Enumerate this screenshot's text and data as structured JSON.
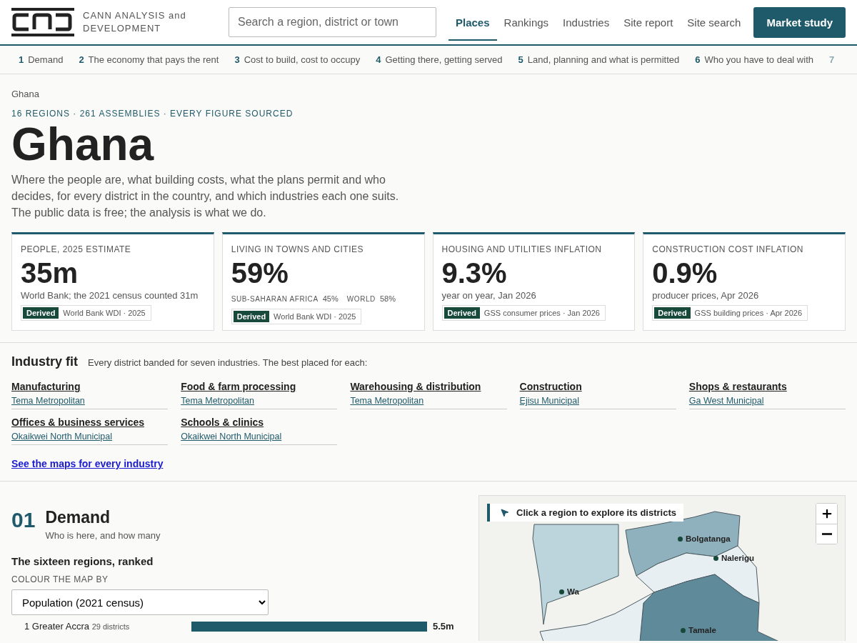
{
  "header": {
    "brand": "CANN ANALYSIS and DEVELOPMENT",
    "search": {
      "placeholder": "Search a region, district or town"
    },
    "nav": [
      {
        "label": "Places",
        "selected": true
      },
      {
        "label": "Rankings",
        "selected": false
      },
      {
        "label": "Industries",
        "selected": false
      },
      {
        "label": "Site report",
        "selected": false
      },
      {
        "label": "Site search",
        "selected": false
      }
    ],
    "cta": "Market study"
  },
  "chapters": [
    {
      "number": "1",
      "label": "Demand"
    },
    {
      "number": "2",
      "label": "The economy that pays the rent"
    },
    {
      "number": "3",
      "label": "Cost to build, cost to occupy"
    },
    {
      "number": "4",
      "label": "Getting there, getting served"
    },
    {
      "number": "5",
      "label": "Land, planning and what is permitted"
    },
    {
      "number": "6",
      "label": "Who you have to deal with"
    },
    {
      "number": "7"
    }
  ],
  "breadcrumb": "Ghana",
  "eyebrow": "16 REGIONS · 261 ASSEMBLIES · EVERY FIGURE SOURCED",
  "title": "Ghana",
  "intro": "Where the people are, what building costs, what the plans permit and who decides, for every district in the country, and which industries each one suits. The public data is free; the analysis is what we do.",
  "stats": [
    {
      "label": "PEOPLE, 2025 ESTIMATE",
      "value": "35m",
      "note": "World Bank; the 2021 census counted 31m",
      "badge": "Derived",
      "source": "World Bank WDI · 2025"
    },
    {
      "label": "LIVING IN TOWNS AND CITIES",
      "value": "59%",
      "comparisons": [
        {
          "label": "SUB-SAHARAN AFRICA",
          "value": "45%"
        },
        {
          "label": "WORLD",
          "value": "58%"
        }
      ],
      "badge": "Derived",
      "source": "World Bank WDI · 2025"
    },
    {
      "label": "HOUSING AND UTILITIES INFLATION",
      "value": "9.3%",
      "note": "year on year, Jan 2026",
      "badge": "Derived",
      "source": "GSS consumer prices · Jan 2026"
    },
    {
      "label": "CONSTRUCTION COST INFLATION",
      "value": "0.9%",
      "note": "producer prices, Apr 2026",
      "badge": "Derived",
      "source": "GSS building prices · Apr 2026"
    }
  ],
  "industry_fit": {
    "title": "Industry fit",
    "subtitle": "Every district banded for seven industries. The best placed for each:",
    "items": [
      {
        "industry": "Manufacturing",
        "best": "Tema Metropolitan"
      },
      {
        "industry": "Food & farm processing",
        "best": "Tema Metropolitan"
      },
      {
        "industry": "Warehousing & distribution",
        "best": "Tema Metropolitan"
      },
      {
        "industry": "Construction",
        "best": "Ejisu Municipal"
      },
      {
        "industry": "Shops & restaurants",
        "best": "Ga West Municipal"
      },
      {
        "industry": "Offices & business services",
        "best": "Okaikwei North Municipal"
      },
      {
        "industry": "Schools & clinics",
        "best": "Okaikwei North Municipal"
      }
    ],
    "link": "See the maps for every industry"
  },
  "demand": {
    "number": "01",
    "title": "Demand",
    "subtitle": "Who is here, and how many",
    "subheading": "The sixteen regions, ranked",
    "select_label": "COLOUR THE MAP BY",
    "select_value": "Population (2021 census)",
    "ranking": [
      {
        "rank": "1",
        "name": "Greater Accra",
        "districts": "29 districts",
        "level": 1,
        "value": "5.5m"
      }
    ]
  },
  "map": {
    "hint": "Click a region to explore its districts",
    "towns": [
      {
        "name": "Bolgatanga"
      },
      {
        "name": "Nalerigu"
      },
      {
        "name": "Wa"
      },
      {
        "name": "Tamale"
      }
    ]
  }
}
